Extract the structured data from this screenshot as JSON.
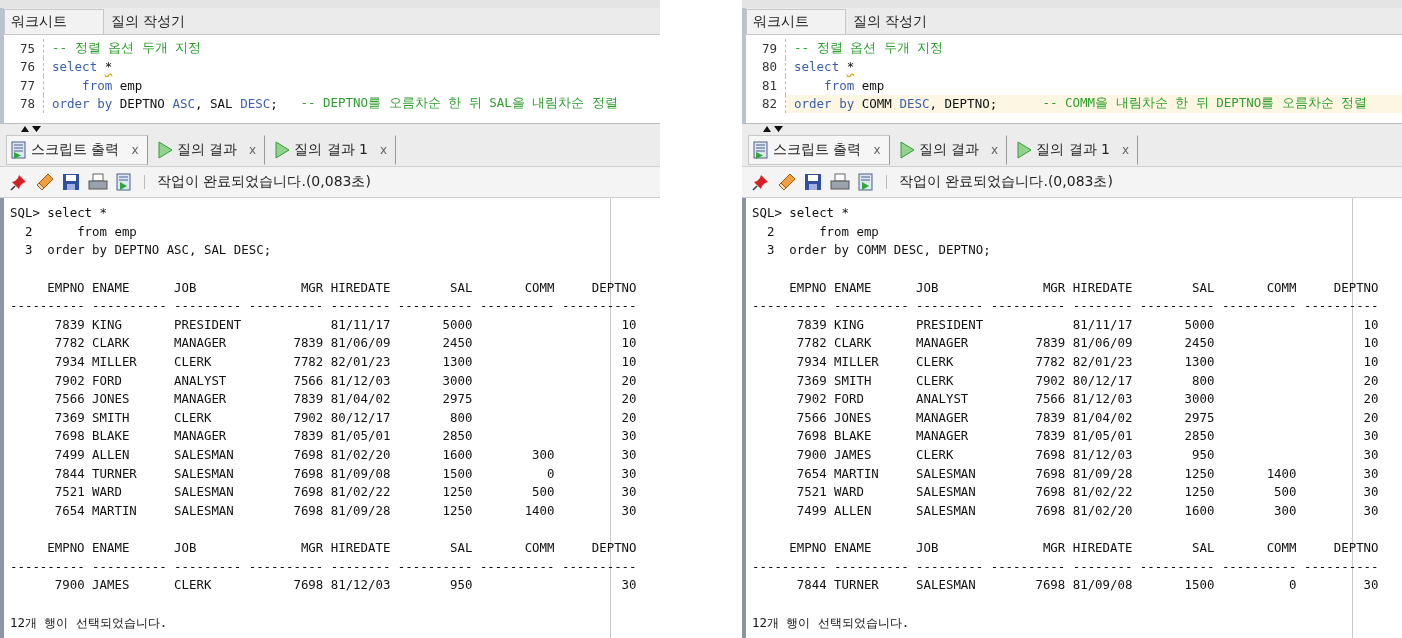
{
  "panels": [
    {
      "editor_tabs": [
        {
          "label": "워크시트",
          "selected": true
        },
        {
          "label": "질의 작성기",
          "selected": false
        }
      ],
      "editor_lines": [
        {
          "number": "75",
          "highlighted": false,
          "tokens": [
            {
              "kind": "comment",
              "text": "-- 정렬 옵션 두개 지정"
            }
          ]
        },
        {
          "number": "76",
          "highlighted": false,
          "tokens": [
            {
              "kind": "keyword",
              "text": "select "
            },
            {
              "kind": "flagged",
              "text": "*"
            }
          ]
        },
        {
          "number": "77",
          "highlighted": false,
          "tokens": [
            {
              "kind": "keyword",
              "text": "    from "
            },
            {
              "kind": "plain",
              "text": "emp"
            }
          ]
        },
        {
          "number": "78",
          "highlighted": false,
          "tokens": [
            {
              "kind": "keyword",
              "text": "order by "
            },
            {
              "kind": "plain",
              "text": "DEPTNO "
            },
            {
              "kind": "keyword",
              "text": "ASC"
            },
            {
              "kind": "plain",
              "text": ", SAL "
            },
            {
              "kind": "keyword",
              "text": "DESC"
            },
            {
              "kind": "plain",
              "text": ";   "
            },
            {
              "kind": "comment",
              "text": "-- DEPTNO를 오름차순 한 뒤 SAL을 내림차순 정렬"
            }
          ]
        }
      ],
      "output_tabs": [
        {
          "kind": "script",
          "label": "스크립트 출력",
          "close": "x",
          "selected": true
        },
        {
          "kind": "query",
          "label": "질의 결과",
          "close": "x",
          "selected": false
        },
        {
          "kind": "query",
          "label": "질의 결과 1",
          "close": "x",
          "selected": false
        }
      ],
      "status": "작업이 완료되었습니다.(0,083초)",
      "echo": [
        "SQL> select *",
        "  2      from emp",
        "  3  order by DEPTNO ASC, SAL DESC;"
      ],
      "tables": [
        {
          "columns": [
            {
              "name": "EMPNO",
              "rule": "----------",
              "kind": "number"
            },
            {
              "name": "ENAME",
              "rule": "----------",
              "kind": "text"
            },
            {
              "name": "JOB",
              "rule": "---------",
              "kind": "text"
            },
            {
              "name": "MGR",
              "rule": "----------",
              "kind": "number"
            },
            {
              "name": "HIREDATE",
              "rule": "--------",
              "kind": "text"
            },
            {
              "name": "SAL",
              "rule": "----------",
              "kind": "number"
            },
            {
              "name": "COMM",
              "rule": "----------",
              "kind": "number"
            },
            {
              "name": "DEPTNO",
              "rule": "----------",
              "kind": "number"
            }
          ],
          "rows": [
            [
              "7839",
              "KING",
              "PRESIDENT",
              null,
              "81/11/17",
              "5000",
              null,
              "10"
            ],
            [
              "7782",
              "CLARK",
              "MANAGER",
              "7839",
              "81/06/09",
              "2450",
              null,
              "10"
            ],
            [
              "7934",
              "MILLER",
              "CLERK",
              "7782",
              "82/01/23",
              "1300",
              null,
              "10"
            ],
            [
              "7902",
              "FORD",
              "ANALYST",
              "7566",
              "81/12/03",
              "3000",
              null,
              "20"
            ],
            [
              "7566",
              "JONES",
              "MANAGER",
              "7839",
              "81/04/02",
              "2975",
              null,
              "20"
            ],
            [
              "7369",
              "SMITH",
              "CLERK",
              "7902",
              "80/12/17",
              "800",
              null,
              "20"
            ],
            [
              "7698",
              "BLAKE",
              "MANAGER",
              "7839",
              "81/05/01",
              "2850",
              null,
              "30"
            ],
            [
              "7499",
              "ALLEN",
              "SALESMAN",
              "7698",
              "81/02/20",
              "1600",
              "300",
              "30"
            ],
            [
              "7844",
              "TURNER",
              "SALESMAN",
              "7698",
              "81/09/08",
              "1500",
              "0",
              "30"
            ],
            [
              "7521",
              "WARD",
              "SALESMAN",
              "7698",
              "81/02/22",
              "1250",
              "500",
              "30"
            ],
            [
              "7654",
              "MARTIN",
              "SALESMAN",
              "7698",
              "81/09/28",
              "1250",
              "1400",
              "30"
            ]
          ]
        },
        {
          "columns": [
            {
              "name": "EMPNO",
              "rule": "----------",
              "kind": "number"
            },
            {
              "name": "ENAME",
              "rule": "----------",
              "kind": "text"
            },
            {
              "name": "JOB",
              "rule": "---------",
              "kind": "text"
            },
            {
              "name": "MGR",
              "rule": "----------",
              "kind": "number"
            },
            {
              "name": "HIREDATE",
              "rule": "--------",
              "kind": "text"
            },
            {
              "name": "SAL",
              "rule": "----------",
              "kind": "number"
            },
            {
              "name": "COMM",
              "rule": "----------",
              "kind": "number"
            },
            {
              "name": "DEPTNO",
              "rule": "----------",
              "kind": "number"
            }
          ],
          "rows": [
            [
              "7900",
              "JAMES",
              "CLERK",
              "7698",
              "81/12/03",
              "950",
              null,
              "30"
            ]
          ]
        }
      ],
      "footer": "12개 행이 선택되었습니다."
    },
    {
      "editor_tabs": [
        {
          "label": "워크시트",
          "selected": true
        },
        {
          "label": "질의 작성기",
          "selected": false
        }
      ],
      "editor_lines": [
        {
          "number": "79",
          "highlighted": false,
          "tokens": [
            {
              "kind": "comment",
              "text": "-- 정렬 옵션 두개 지정"
            }
          ]
        },
        {
          "number": "80",
          "highlighted": false,
          "tokens": [
            {
              "kind": "keyword",
              "text": "select "
            },
            {
              "kind": "flagged",
              "text": "*"
            }
          ]
        },
        {
          "number": "81",
          "highlighted": false,
          "tokens": [
            {
              "kind": "keyword",
              "text": "    from "
            },
            {
              "kind": "plain",
              "text": "emp"
            }
          ]
        },
        {
          "number": "82",
          "highlighted": true,
          "tokens": [
            {
              "kind": "keyword",
              "text": "order by "
            },
            {
              "kind": "plain",
              "text": "COMM "
            },
            {
              "kind": "keyword",
              "text": "DESC"
            },
            {
              "kind": "plain",
              "text": ", DEPTNO;      "
            },
            {
              "kind": "comment",
              "text": "-- COMM을 내림차순 한 뒤 DEPTNO를 오름차순 정렬"
            }
          ]
        }
      ],
      "output_tabs": [
        {
          "kind": "script",
          "label": "스크립트 출력",
          "close": "x",
          "selected": true
        },
        {
          "kind": "query",
          "label": "질의 결과",
          "close": "x",
          "selected": false
        },
        {
          "kind": "query",
          "label": "질의 결과 1",
          "close": "x",
          "selected": false
        }
      ],
      "status": "작업이 완료되었습니다.(0,083초)",
      "echo": [
        "SQL> select *",
        "  2      from emp",
        "  3  order by COMM DESC, DEPTNO;"
      ],
      "tables": [
        {
          "columns": [
            {
              "name": "EMPNO",
              "rule": "----------",
              "kind": "number"
            },
            {
              "name": "ENAME",
              "rule": "----------",
              "kind": "text"
            },
            {
              "name": "JOB",
              "rule": "---------",
              "kind": "text"
            },
            {
              "name": "MGR",
              "rule": "----------",
              "kind": "number"
            },
            {
              "name": "HIREDATE",
              "rule": "--------",
              "kind": "text"
            },
            {
              "name": "SAL",
              "rule": "----------",
              "kind": "number"
            },
            {
              "name": "COMM",
              "rule": "----------",
              "kind": "number"
            },
            {
              "name": "DEPTNO",
              "rule": "----------",
              "kind": "number"
            }
          ],
          "rows": [
            [
              "7839",
              "KING",
              "PRESIDENT",
              null,
              "81/11/17",
              "5000",
              null,
              "10"
            ],
            [
              "7782",
              "CLARK",
              "MANAGER",
              "7839",
              "81/06/09",
              "2450",
              null,
              "10"
            ],
            [
              "7934",
              "MILLER",
              "CLERK",
              "7782",
              "82/01/23",
              "1300",
              null,
              "10"
            ],
            [
              "7369",
              "SMITH",
              "CLERK",
              "7902",
              "80/12/17",
              "800",
              null,
              "20"
            ],
            [
              "7902",
              "FORD",
              "ANALYST",
              "7566",
              "81/12/03",
              "3000",
              null,
              "20"
            ],
            [
              "7566",
              "JONES",
              "MANAGER",
              "7839",
              "81/04/02",
              "2975",
              null,
              "20"
            ],
            [
              "7698",
              "BLAKE",
              "MANAGER",
              "7839",
              "81/05/01",
              "2850",
              null,
              "30"
            ],
            [
              "7900",
              "JAMES",
              "CLERK",
              "7698",
              "81/12/03",
              "950",
              null,
              "30"
            ],
            [
              "7654",
              "MARTIN",
              "SALESMAN",
              "7698",
              "81/09/28",
              "1250",
              "1400",
              "30"
            ],
            [
              "7521",
              "WARD",
              "SALESMAN",
              "7698",
              "81/02/22",
              "1250",
              "500",
              "30"
            ],
            [
              "7499",
              "ALLEN",
              "SALESMAN",
              "7698",
              "81/02/20",
              "1600",
              "300",
              "30"
            ]
          ]
        },
        {
          "columns": [
            {
              "name": "EMPNO",
              "rule": "----------",
              "kind": "number"
            },
            {
              "name": "ENAME",
              "rule": "----------",
              "kind": "text"
            },
            {
              "name": "JOB",
              "rule": "---------",
              "kind": "text"
            },
            {
              "name": "MGR",
              "rule": "----------",
              "kind": "number"
            },
            {
              "name": "HIREDATE",
              "rule": "--------",
              "kind": "text"
            },
            {
              "name": "SAL",
              "rule": "----------",
              "kind": "number"
            },
            {
              "name": "COMM",
              "rule": "----------",
              "kind": "number"
            },
            {
              "name": "DEPTNO",
              "rule": "----------",
              "kind": "number"
            }
          ],
          "rows": [
            [
              "7844",
              "TURNER",
              "SALESMAN",
              "7698",
              "81/09/08",
              "1500",
              "0",
              "30"
            ]
          ]
        }
      ],
      "footer": "12개 행이 선택되었습니다."
    }
  ]
}
